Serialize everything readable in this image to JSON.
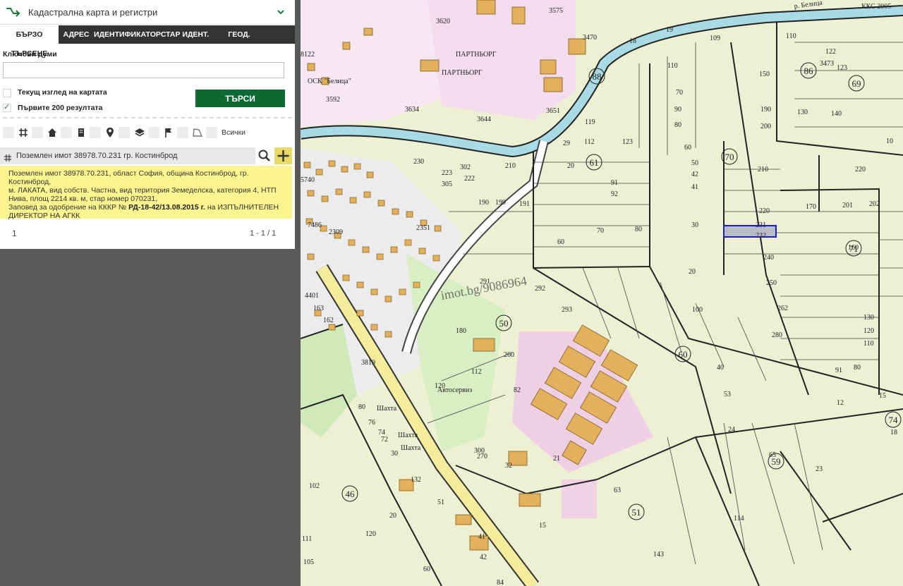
{
  "header": {
    "title": "Кадастрална карта и регистри"
  },
  "tabs": [
    {
      "label": "БЪРЗО ТЪРСЕНЕ",
      "active": true
    },
    {
      "label": "АДРЕС"
    },
    {
      "label": "ИДЕНТИФИКАТОР"
    },
    {
      "label": "СТАР ИДЕНТ."
    },
    {
      "label": "ГЕОД. ОСНОВА"
    }
  ],
  "search": {
    "keywords_label": "Ключови думи",
    "keywords_value": "",
    "current_view_label": "Текущ изглед на картата",
    "current_view_checked": false,
    "first200_label": "Първите 200 резултата",
    "first200_checked": true,
    "button_label": "ТЪРСИ"
  },
  "filters": {
    "icons": [
      "grid-icon",
      "home-icon",
      "building-icon",
      "location-pin-icon",
      "layers-icon",
      "flag-icon",
      "polygon-icon"
    ],
    "all_label": "Всички"
  },
  "result": {
    "title": "Поземлен имот 38978.70.231 гр. Костинброд",
    "line1": "Поземлен имот 38978.70.231, област София, община Костинброд, гр. Костинброд,",
    "line2": "м. ЛАКАТА, вид собств. Частна, вид територия Земеделска, категория 4, НТП",
    "line3": "Нива, площ 2214 кв. м, стар номер 070231,",
    "line4_prefix": "Заповед за одобрение на КККР № ",
    "line4_bold": "РД-18-42/13.08.2015 г.",
    "line4_suffix": " на ИЗПЪЛНИТЕЛЕН",
    "line5": "ДИРЕКТОР НА АГКК"
  },
  "pagination": {
    "page": "1",
    "range": "1 - 1 / 1"
  },
  "map": {
    "labels": {
      "kks": "ККС 2005",
      "river": "р. Белица",
      "watermark": "imot.bg/9086964",
      "partnyor": "ПАРТНЬОРГ",
      "osk": "ОСК \"Белица\"",
      "shahta": "Шахта",
      "avtoservice": "Автосервиз"
    },
    "circled": [
      "86",
      "69",
      "88",
      "70",
      "61",
      "71",
      "50",
      "60",
      "46",
      "51",
      "59",
      "74"
    ],
    "parcels": [
      "231",
      "232",
      "220",
      "240",
      "250",
      "262",
      "280",
      "210",
      "200",
      "190",
      "150",
      "110",
      "70",
      "90",
      "80",
      "60",
      "50",
      "42",
      "41",
      "30",
      "20",
      "100",
      "40",
      "53",
      "24",
      "65",
      "63",
      "114",
      "143",
      "15",
      "21",
      "82",
      "112",
      "120",
      "180",
      "260",
      "291",
      "292",
      "293",
      "190",
      "199",
      "191",
      "210",
      "230",
      "223",
      "305",
      "222",
      "302",
      "3634",
      "3644",
      "3651",
      "119",
      "112",
      "123",
      "91",
      "92",
      "70",
      "80",
      "60",
      "29",
      "20",
      "170",
      "201",
      "202",
      "160",
      "130",
      "120",
      "110",
      "91",
      "80",
      "12",
      "15",
      "18",
      "23",
      "122",
      "123",
      "130",
      "140",
      "10",
      "220",
      "5740",
      "7486",
      "2309",
      "2351",
      "4401",
      "163",
      "162",
      "3819",
      "80",
      "76",
      "74",
      "72",
      "30",
      "132",
      "51",
      "20",
      "102",
      "111",
      "120",
      "105",
      "60",
      "42",
      "41",
      "84",
      "300",
      "270",
      "32",
      "8122",
      "3592",
      "3620",
      "18",
      "19",
      "109",
      "110",
      "3473",
      "3470",
      "3575"
    ]
  }
}
